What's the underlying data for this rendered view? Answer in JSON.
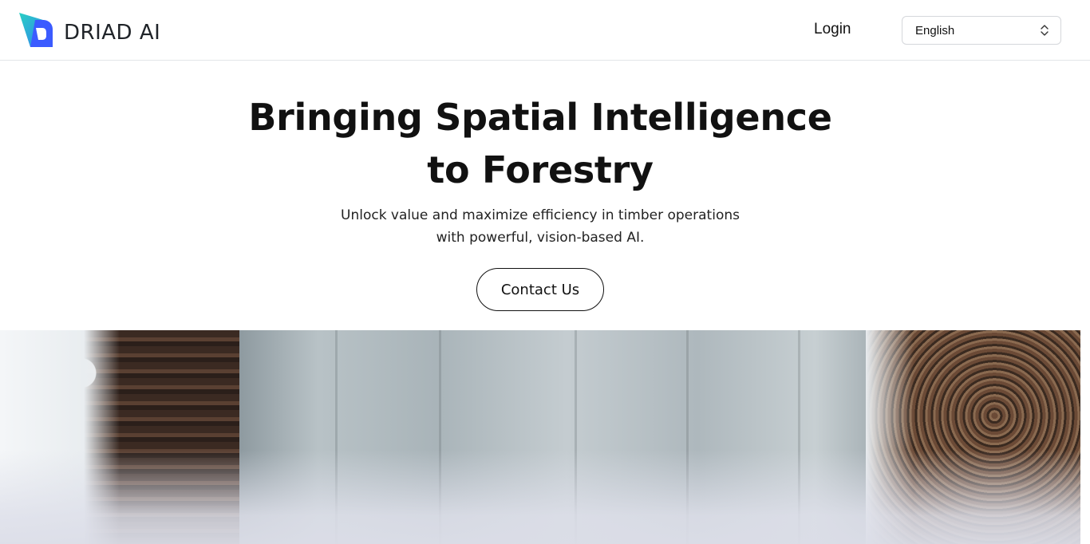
{
  "header": {
    "brand_name": "DRIAD AI",
    "logo_icon": "driad-logo-icon",
    "login_label": "Login",
    "language": {
      "selected": "English",
      "icon": "chevron-up-down-icon"
    }
  },
  "hero": {
    "title_line1": "Bringing Spatial Intelligence",
    "title_line2": "to Forestry",
    "subtitle_line1": "Unlock value and maximize efficiency in timber operations",
    "subtitle_line2": "with powerful, vision-based AI.",
    "cta_label": "Contact Us"
  },
  "banner": {
    "image_subject": "aerial view of snowy road between timber log piles"
  },
  "colors": {
    "logo_blue": "#3b5bff",
    "logo_teal": "#27c4c9",
    "text": "#111111",
    "border": "#e3e5e8"
  }
}
